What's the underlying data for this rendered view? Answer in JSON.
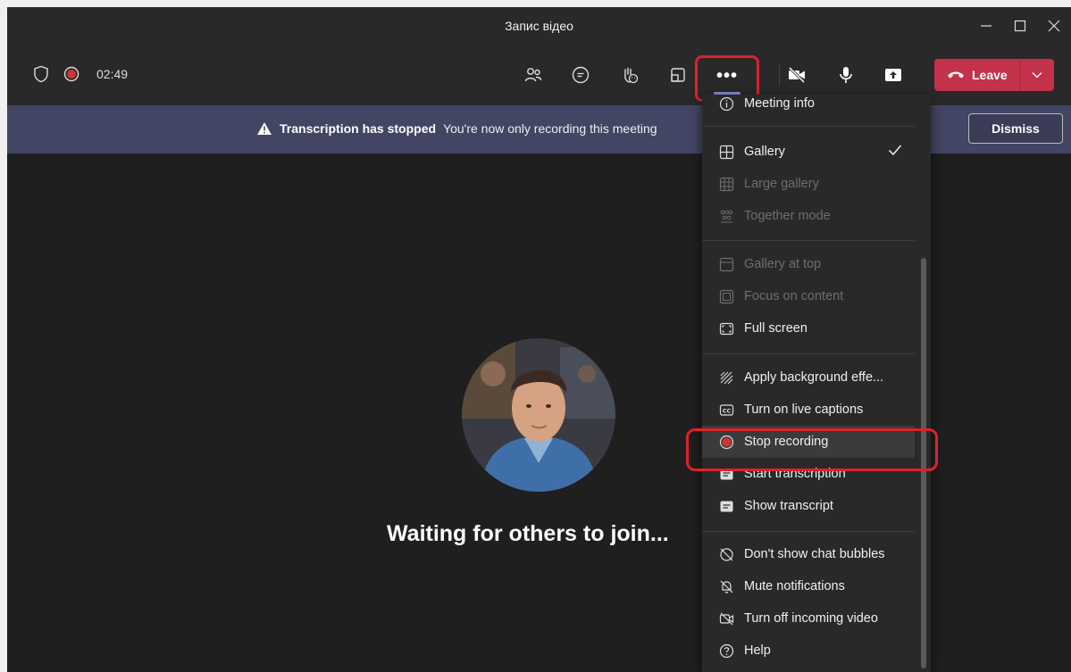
{
  "window": {
    "title": "Запис відео"
  },
  "toolbar": {
    "timer": "02:49",
    "more_label": "•••",
    "leave_label": "Leave"
  },
  "banner": {
    "title": "Transcription has stopped",
    "message": "You're now only recording this meeting",
    "dismiss_label": "Dismiss"
  },
  "stage": {
    "waiting_text": "Waiting for others to join..."
  },
  "menu": {
    "items": [
      {
        "label": "Meeting info",
        "icon": "info-icon",
        "enabled": true
      },
      {
        "label": "Gallery",
        "icon": "gallery-icon",
        "enabled": true,
        "checked": true
      },
      {
        "label": "Large gallery",
        "icon": "large-gallery-icon",
        "enabled": false
      },
      {
        "label": "Together mode",
        "icon": "together-mode-icon",
        "enabled": false
      },
      {
        "label": "Gallery at top",
        "icon": "gallery-top-icon",
        "enabled": false
      },
      {
        "label": "Focus on content",
        "icon": "focus-content-icon",
        "enabled": false
      },
      {
        "label": "Full screen",
        "icon": "fullscreen-icon",
        "enabled": true
      },
      {
        "label": "Apply background effe...",
        "icon": "background-effects-icon",
        "enabled": true
      },
      {
        "label": "Turn on live captions",
        "icon": "captions-icon",
        "enabled": true
      },
      {
        "label": "Stop recording",
        "icon": "record-stop-icon",
        "enabled": true
      },
      {
        "label": "Start transcription",
        "icon": "transcription-icon",
        "enabled": true
      },
      {
        "label": "Show transcript",
        "icon": "transcript-icon",
        "enabled": true
      },
      {
        "label": "Don't show chat bubbles",
        "icon": "chat-bubbles-off-icon",
        "enabled": true
      },
      {
        "label": "Mute notifications",
        "icon": "bell-off-icon",
        "enabled": true
      },
      {
        "label": "Turn off incoming video",
        "icon": "video-off-icon",
        "enabled": true
      },
      {
        "label": "Help",
        "icon": "help-icon",
        "enabled": true
      }
    ]
  },
  "colors": {
    "accent": "#8b8cd6",
    "leave": "#c4314b",
    "recording": "#d13438",
    "highlight": "#e0202a",
    "banner": "#434564"
  }
}
